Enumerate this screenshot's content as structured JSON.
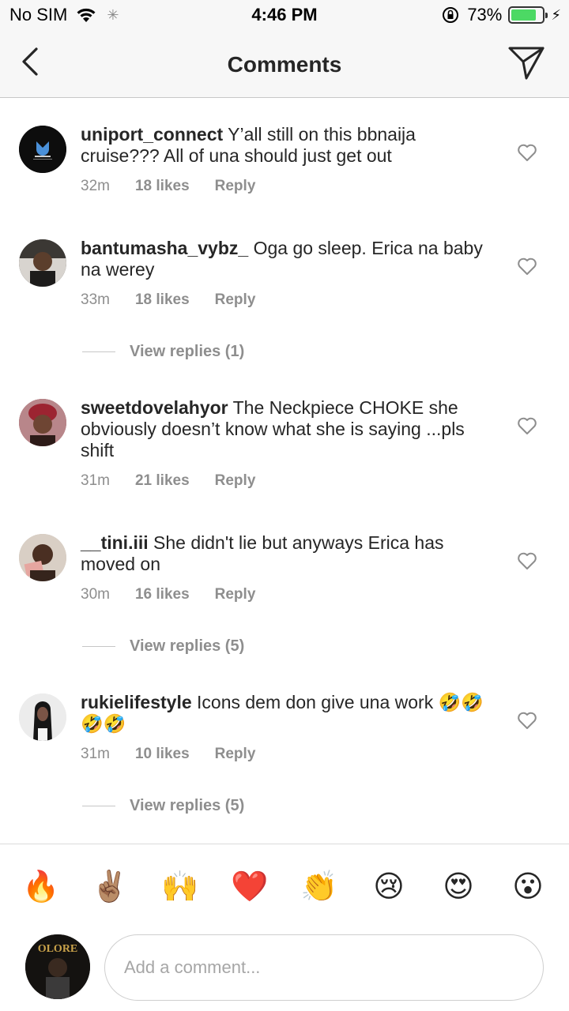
{
  "status_bar": {
    "carrier": "No SIM",
    "time": "4:46 PM",
    "battery": "73%",
    "battery_level": 0.73,
    "icons": [
      "wifi-icon",
      "loading-spinner-icon",
      "orientation-lock-icon",
      "battery-icon",
      "charging-bolt-icon"
    ]
  },
  "header": {
    "title": "Comments",
    "back_icon": "chevron-left-icon",
    "send_icon": "paper-plane-icon"
  },
  "comments": [
    {
      "username": "uniport_connect",
      "text": "Y’all still on this bbnaija cruise??? All of una should just get out",
      "time": "32m",
      "likes": "18 likes",
      "reply": "Reply"
    },
    {
      "username": "bantumasha_vybz_",
      "text": "Oga go sleep. Erica na baby na werey",
      "time": "33m",
      "likes": "18 likes",
      "reply": "Reply",
      "view_replies": "View replies (1)"
    },
    {
      "username": "sweetdovelahyor",
      "text": "The Neckpiece CHOKE she obviously doesn’t know what she is saying ...pls shift",
      "time": "31m",
      "likes": "21 likes",
      "reply": "Reply"
    },
    {
      "username": "__tini.iii",
      "text": "She didn't lie but anyways Erica has moved on",
      "time": "30m",
      "likes": "16 likes",
      "reply": "Reply",
      "view_replies": "View replies (5)"
    },
    {
      "username": "rukielifestyle",
      "text": "Icons dem don give una work 🤣🤣🤣🤣",
      "time": "31m",
      "likes": "10 likes",
      "reply": "Reply",
      "view_replies": "View replies (5)"
    }
  ],
  "quick_reactions": [
    "🔥",
    "✌🏽",
    "🙌",
    "❤️",
    "👏",
    "😢",
    "😍",
    "😮"
  ],
  "composer": {
    "placeholder": "Add a comment...",
    "avatar_label": "OLORE"
  },
  "colors": {
    "text": "#262626",
    "secondary": "#8e8e8e",
    "bar_bg": "#f7f7f7",
    "battery": "#4cd964",
    "heart_like": "#e74c3c"
  }
}
